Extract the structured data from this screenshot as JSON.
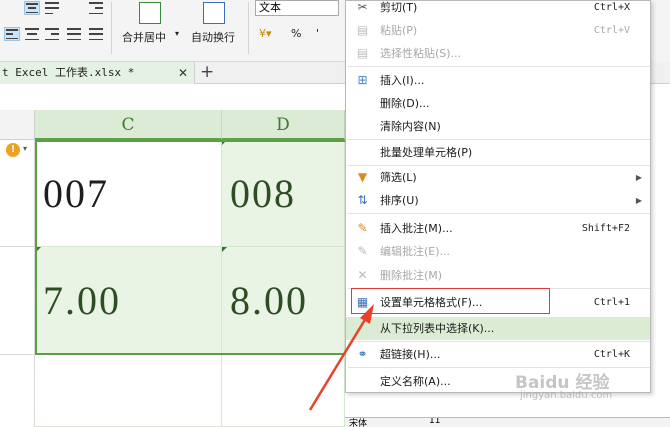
{
  "ribbon": {
    "merge_label": "合并居中",
    "wrap_label": "自动换行",
    "format_value": "文本",
    "percent_symbol": "%",
    "comma_symbol": "'"
  },
  "tabs": {
    "doc_title": "t Excel 工作表.xlsx *",
    "close_symbol": "✕",
    "add_symbol": "+"
  },
  "sheet": {
    "columns": [
      "C",
      "D"
    ],
    "cells": [
      [
        "007",
        "008"
      ],
      [
        "7.00",
        "8.00"
      ]
    ],
    "warning_symbol": "!"
  },
  "context_menu": {
    "items": [
      {
        "label": "剪切(T)",
        "shortcut": "Ctrl+X",
        "icon": "scissors-icon",
        "disabled": false
      },
      {
        "label": "粘贴(P)",
        "shortcut": "Ctrl+V",
        "icon": "paste-icon",
        "disabled": true
      },
      {
        "label": "选择性粘贴(S)...",
        "shortcut": "",
        "icon": "paste-special-icon",
        "disabled": true
      },
      {
        "label": "插入(I)...",
        "shortcut": "",
        "icon": "insert-icon",
        "disabled": false
      },
      {
        "label": "删除(D)...",
        "shortcut": "",
        "icon": "",
        "disabled": false
      },
      {
        "label": "清除内容(N)",
        "shortcut": "",
        "icon": "",
        "disabled": false
      },
      {
        "label": "批量处理单元格(P)",
        "shortcut": "",
        "icon": "",
        "disabled": false
      },
      {
        "label": "筛选(L)",
        "shortcut": "",
        "icon": "filter-icon",
        "disabled": false,
        "submenu": true
      },
      {
        "label": "排序(U)",
        "shortcut": "",
        "icon": "sort-icon",
        "disabled": false,
        "submenu": true
      },
      {
        "label": "插入批注(M)...",
        "shortcut": "Shift+F2",
        "icon": "comment-add-icon",
        "disabled": false
      },
      {
        "label": "编辑批注(E)...",
        "shortcut": "",
        "icon": "comment-edit-icon",
        "disabled": true
      },
      {
        "label": "删除批注(M)",
        "shortcut": "",
        "icon": "comment-delete-icon",
        "disabled": true
      },
      {
        "label": "设置单元格格式(F)...",
        "shortcut": "Ctrl+1",
        "icon": "format-cells-icon",
        "disabled": false
      },
      {
        "label": "从下拉列表中选择(K)...",
        "shortcut": "",
        "icon": "",
        "disabled": false
      },
      {
        "label": "超链接(H)...",
        "shortcut": "Ctrl+K",
        "icon": "hyperlink-icon",
        "disabled": false
      },
      {
        "label": "定义名称(A)...",
        "shortcut": "",
        "icon": "",
        "disabled": false
      }
    ]
  },
  "mini_toolbar": {
    "font_name": "宋体",
    "font_size": "11"
  },
  "watermark": {
    "brand": "Baidu 经验",
    "url": "jingyan.baidu.com"
  },
  "colors": {
    "accent_green": "#5a9e47",
    "highlight": "#dcecd4",
    "annotation_red": "#e03a3a"
  }
}
